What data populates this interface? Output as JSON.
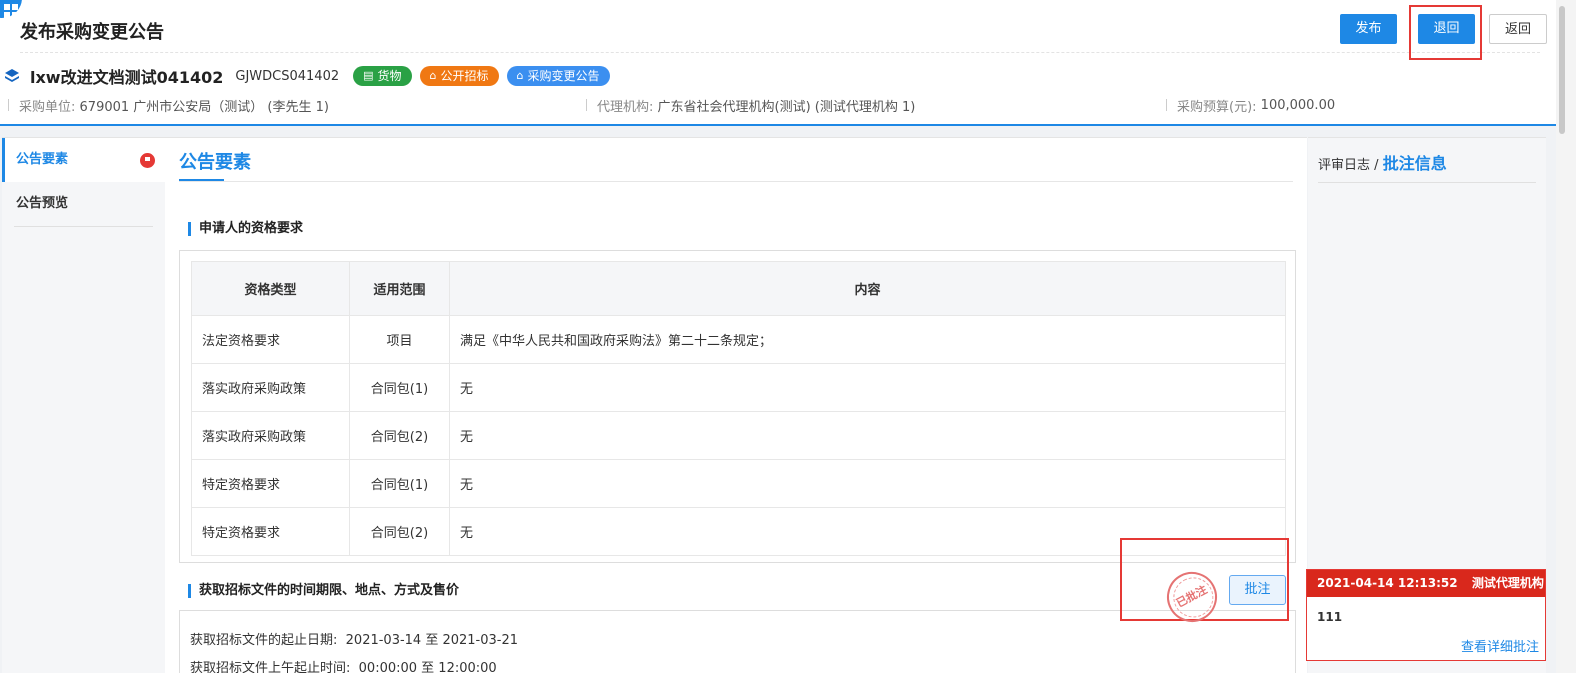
{
  "header": {
    "title": "发布采购变更公告",
    "actions": {
      "publish": "发布",
      "send_back": "退回",
      "back": "返回"
    }
  },
  "project": {
    "name": "lxw改进文档测试041402",
    "code": "GJWDCS041402",
    "tags": [
      {
        "label": "货物",
        "color": "#2aa145"
      },
      {
        "label": "公开招标",
        "color": "#f07813"
      },
      {
        "label": "采购变更公告",
        "color": "#3b8ff0"
      }
    ],
    "info": [
      {
        "label": "采购单位:",
        "value": "679001 广州市公安局（测试） (李先生 1)"
      },
      {
        "label": "代理机构:",
        "value": "广东省社会代理机构(测试) (测试代理机构 1)"
      },
      {
        "label": "采购预算(元):",
        "value": "100,000.00"
      }
    ]
  },
  "sidebar": {
    "items": [
      {
        "label": "公告要素",
        "active": true
      },
      {
        "label": "公告预览",
        "active": false
      }
    ]
  },
  "main": {
    "title": "公告要素",
    "section1_title": "申请人的资格要求",
    "table": {
      "headers": [
        "资格类型",
        "适用范围",
        "内容"
      ],
      "rows": [
        [
          "法定资格要求",
          "项目",
          "满足《中华人民共和国政府采购法》第二十二条规定；"
        ],
        [
          "落实政府采购政策",
          "合同包(1)",
          "无"
        ],
        [
          "落实政府采购政策",
          "合同包(2)",
          "无"
        ],
        [
          "特定资格要求",
          "合同包(1)",
          "无"
        ],
        [
          "特定资格要求",
          "合同包(2)",
          "无"
        ]
      ]
    },
    "section2_title": "获取招标文件的时间期限、地点、方式及售价",
    "dates": [
      {
        "label": "获取招标文件的起止日期:",
        "value": "2021-03-14 至 2021-03-21"
      },
      {
        "label": "获取招标文件上午起止时间:",
        "value": "00:00:00 至 12:00:00"
      }
    ],
    "stamp_text": "已批注",
    "annotate_button": "批注"
  },
  "right_panel": {
    "tab_log": "评审日志",
    "separator": "/",
    "tab_annotations": "批注信息",
    "comment": {
      "time": "2021-04-14 12:13:52",
      "author": "测试代理机构",
      "text": "111",
      "link": "查看详细批注"
    }
  }
}
